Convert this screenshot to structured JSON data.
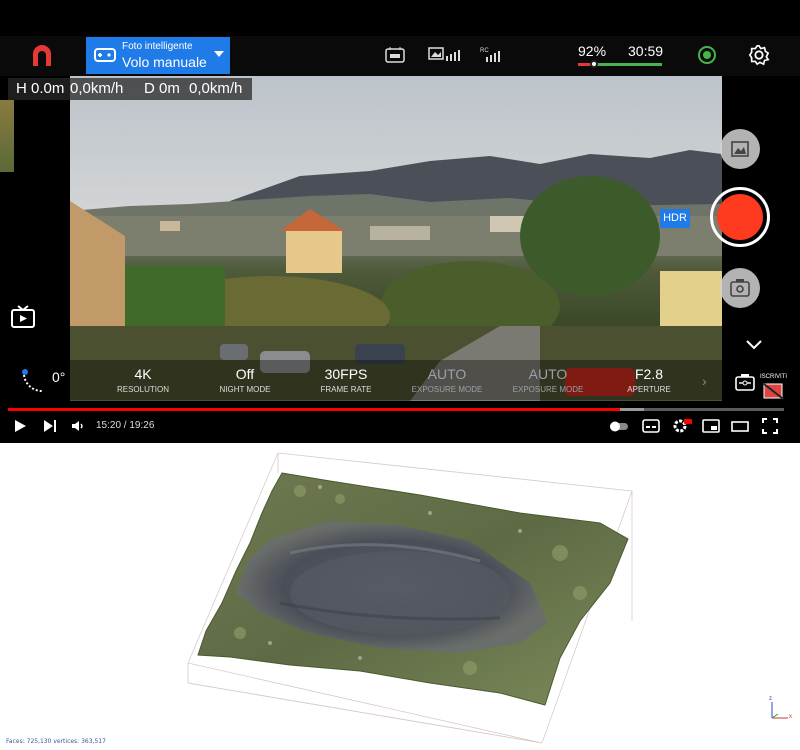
{
  "app": {
    "mode_sub": "Foto intelligente",
    "mode_main": "Volo manuale",
    "battery": "92%",
    "flight_time": "30:59",
    "hdr": "HDR"
  },
  "telemetry": {
    "height": "H 0.0m",
    "h_speed": "0,0km/h",
    "distance": "D 0m",
    "d_speed": "0,0km/h"
  },
  "gimbal": {
    "angle": "0°"
  },
  "camera_settings": [
    {
      "value": "4K",
      "label": "RESOLUTION",
      "dim": false
    },
    {
      "value": "Off",
      "label": "NIGHT MODE",
      "dim": false
    },
    {
      "value": "30FPS",
      "label": "FRAME RATE",
      "dim": false
    },
    {
      "value": "AUTO",
      "label": "EXPOSURE MODE",
      "dim": true
    },
    {
      "value": "AUTO",
      "label": "EXPOSURE MODE",
      "dim": true
    },
    {
      "value": "F2.8",
      "label": "APERTURE",
      "dim": false
    }
  ],
  "subscribe": {
    "label": "ISCRIVITI"
  },
  "player": {
    "time": "15:20 / 19:26",
    "progress": 0.789,
    "buffered": 0.82
  },
  "model": {
    "stats": "Faces: 725,130 vertices: 363,517",
    "axes": {
      "z": "z",
      "x": "x"
    }
  },
  "colors": {
    "accent": "#1f7be8",
    "record": "#ff3b1f",
    "progress": "#ff0000"
  }
}
